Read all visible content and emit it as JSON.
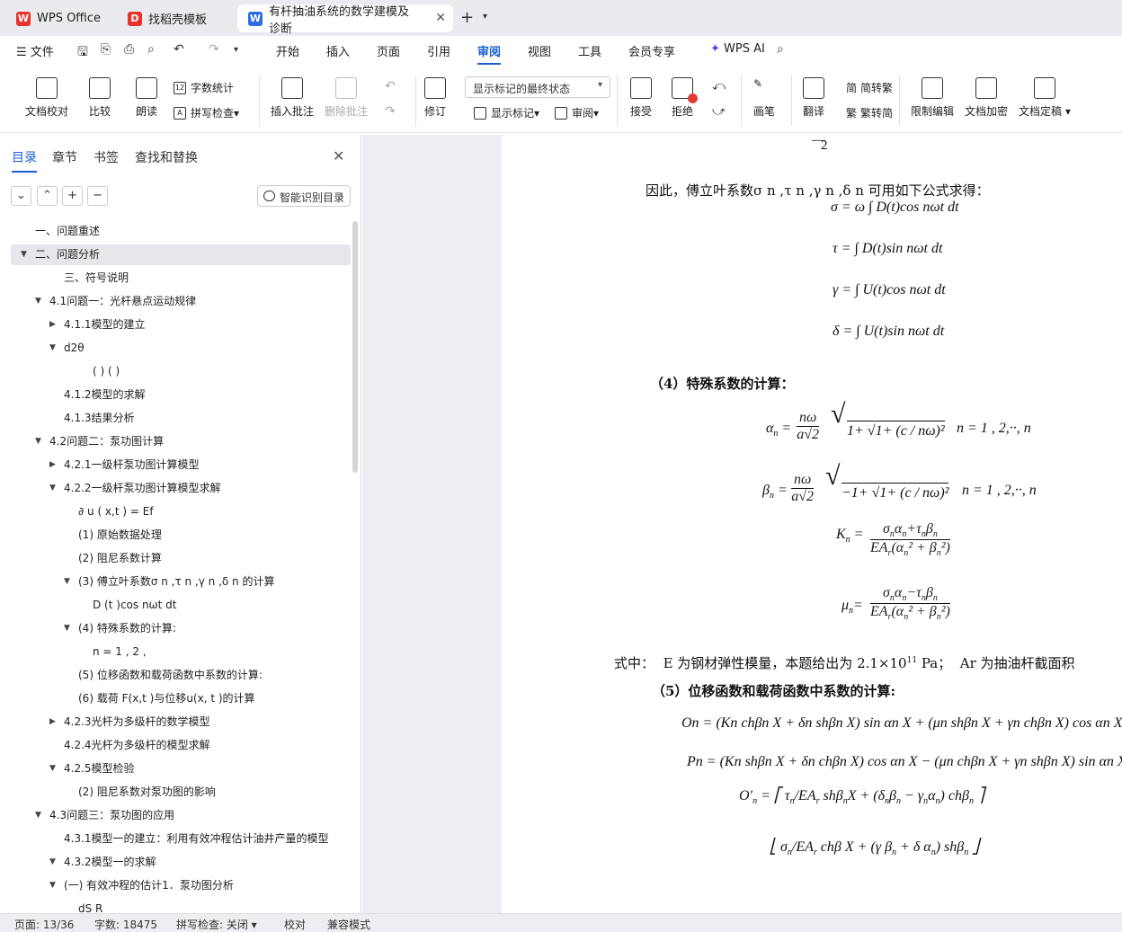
{
  "tabs": [
    {
      "label": "WPS Office",
      "color": "#e8332a",
      "glyph": "W"
    },
    {
      "label": "找稻壳模板",
      "color": "#e8332a",
      "glyph": "D"
    },
    {
      "label": "有杆抽油系统的数学建模及诊断",
      "color": "#2b6de1",
      "glyph": "W"
    }
  ],
  "menu": {
    "file": "文件",
    "items": [
      "开始",
      "插入",
      "页面",
      "引用",
      "审阅",
      "视图",
      "工具",
      "会员专享"
    ],
    "ai": "WPS AI",
    "active": "审阅"
  },
  "toolbar": {
    "proof": "文档校对",
    "compare": "比较",
    "read": "朗读",
    "wordcount": "字数统计",
    "spell": "拼写检查",
    "insert_comment": "插入批注",
    "delete_comment": "删除批注",
    "revise": "修订",
    "markup_state": "显示标记的最终状态",
    "show_markup": "显示标记",
    "review": "审阅",
    "accept": "接受",
    "reject": "拒绝",
    "pen": "画笔",
    "translate": "翻译",
    "to_trad": "简转繁",
    "to_simp": "繁转简",
    "restrict": "限制编辑",
    "encrypt": "文档加密",
    "finalize": "文档定稿"
  },
  "nav": {
    "tabs": [
      "目录",
      "章节",
      "书签",
      "查找和替换"
    ],
    "smart": "智能识别目录",
    "toc": [
      {
        "text": "一、问题重述",
        "indent": 0,
        "arrow": ""
      },
      {
        "text": "二、问题分析",
        "indent": 0,
        "arrow": "down",
        "selected": true
      },
      {
        "text": "三、符号说明",
        "indent": 2,
        "arrow": ""
      },
      {
        "text": "4.1问题一：光杆悬点运动规律",
        "indent": 1,
        "arrow": "down"
      },
      {
        "text": "4.1.1模型的建立",
        "indent": 2,
        "arrow": "right"
      },
      {
        "text": "d2θ",
        "indent": 2,
        "arrow": "down"
      },
      {
        "text": "( ) ( )",
        "indent": 4,
        "arrow": ""
      },
      {
        "text": "4.1.2模型的求解",
        "indent": 2,
        "arrow": ""
      },
      {
        "text": "4.1.3结果分析",
        "indent": 2,
        "arrow": ""
      },
      {
        "text": "4.2问题二：泵功图计算",
        "indent": 1,
        "arrow": "down"
      },
      {
        "text": "4.2.1一级杆泵功图计算模型",
        "indent": 2,
        "arrow": "right"
      },
      {
        "text": "4.2.2一级杆泵功图计算模型求解",
        "indent": 2,
        "arrow": "down"
      },
      {
        "text": "∂ u ( x,t ) = Ef",
        "indent": 3,
        "arrow": ""
      },
      {
        "text": "(1) 原始数据处理",
        "indent": 3,
        "arrow": ""
      },
      {
        "text": "(2) 阻尼系数计算",
        "indent": 3,
        "arrow": ""
      },
      {
        "text": "(3) 傅立叶系数σ n ,τ n ,γ n ,δ n 的计算",
        "indent": 3,
        "arrow": "down"
      },
      {
        "text": "D (t )cos nωt dt",
        "indent": 4,
        "arrow": ""
      },
      {
        "text": "(4) 特殊系数的计算:",
        "indent": 3,
        "arrow": "down"
      },
      {
        "text": "n = 1 , 2 ,",
        "indent": 4,
        "arrow": ""
      },
      {
        "text": "(5) 位移函数和载荷函数中系数的计算:",
        "indent": 3,
        "arrow": ""
      },
      {
        "text": "(6) 载荷 F(x,t )与位移u(x, t )的计算",
        "indent": 3,
        "arrow": ""
      },
      {
        "text": "4.2.3光杆为多级杆的数学模型",
        "indent": 2,
        "arrow": "right"
      },
      {
        "text": "4.2.4光杆为多级杆的模型求解",
        "indent": 2,
        "arrow": ""
      },
      {
        "text": "4.2.5模型检验",
        "indent": 2,
        "arrow": "down"
      },
      {
        "text": "(2) 阻尼系数对泵功图的影响",
        "indent": 3,
        "arrow": ""
      },
      {
        "text": "4.3问题三：泵功图的应用",
        "indent": 1,
        "arrow": "down"
      },
      {
        "text": "4.3.1模型一的建立：利用有效冲程估计油井产量的模型",
        "indent": 2,
        "arrow": ""
      },
      {
        "text": "4.3.2模型一的求解",
        "indent": 2,
        "arrow": "down"
      },
      {
        "text": "(一) 有效冲程的估计1．泵功图分析",
        "indent": 2,
        "arrow": "down"
      },
      {
        "text": "dS R",
        "indent": 3,
        "arrow": ""
      }
    ]
  },
  "doc": {
    "para1": "因此，傅立叶系数σ n ,τ n ,γ n ,δ n 可用如下公式求得：",
    "h4": "（4）特殊系数的计算：",
    "para2a": "式中：",
    "para2b": "E 为钢材弹性模量，本题给出为",
    "para2c": "2.1×10",
    "para2sup": "11",
    "para2d": " Pa；",
    "para2e": "A",
    "para2f": "r 为抽油杆截面积",
    "h5": "（5）位移函数和载荷函数中系数的计算:",
    "f_sigma": "σ = ω ∫ D(t)cos nωt dt",
    "f_tau": "τ = ∫ D(t)sin nωt dt",
    "f_gamma": "γ = ∫ U(t)cos nωt dt",
    "f_delta": "δ = ∫ U(t)sin nωt dt",
    "f_alpha": "n = 1 , 2,··, n",
    "f_beta": "n = 1 , 2,··, n",
    "f_On": "On = (Kn chβn X + δn shβn X) sin αn X + (μn shβn X + γn chβn X) cos αn X",
    "f_Pn": "Pn = (Kn shβn X + δn chβn X) cos αn X − (μn chβn X + γn shβn X) sin αn X"
  },
  "status": {
    "page": "页面: 13/36",
    "words": "字数: 18475",
    "spell": "拼写检查: 关闭",
    "proof": "校对",
    "compat": "兼容模式"
  }
}
